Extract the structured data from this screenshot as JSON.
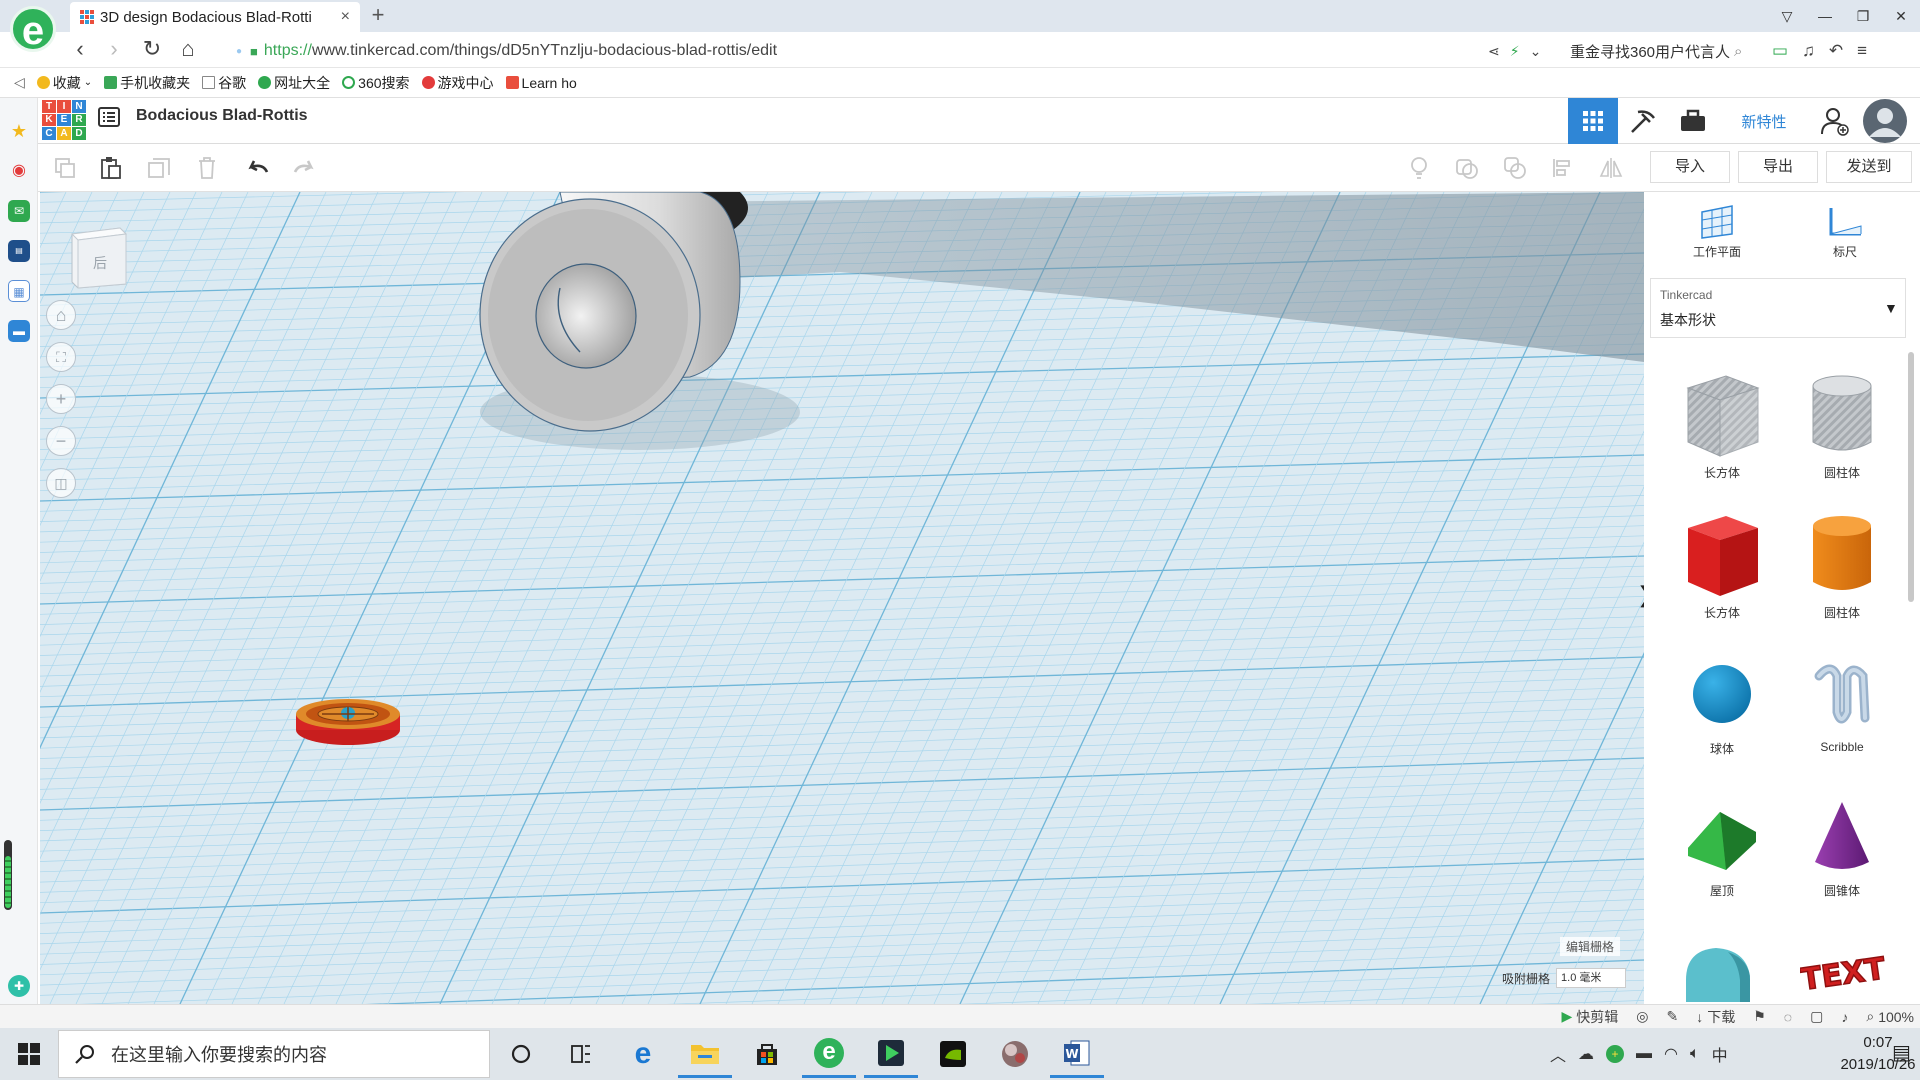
{
  "browser": {
    "logo_letter": "e",
    "tab": {
      "title": "3D design Bodacious Blad-Rotti",
      "close": "×"
    },
    "new_tab": "+",
    "window_controls": [
      "▽",
      "—",
      "❐",
      "✕"
    ],
    "nav": {
      "back": "‹",
      "forward": "›",
      "reload": "↻",
      "home": "⌂"
    },
    "url": {
      "scheme": "https://",
      "rest": "www.tinkercad.com/things/dD5nYTnzlju-bodacious-blad-rottis/edit"
    },
    "search_text": "重金寻找360用户代言人",
    "bookmarks": [
      {
        "label": "收藏",
        "color": "#f2b91e"
      },
      {
        "label": "手机收藏夹",
        "color": "#3aa757"
      },
      {
        "label": "谷歌",
        "color": "#888888"
      },
      {
        "label": "网址大全",
        "color": "#2fa84f"
      },
      {
        "label": "360搜索",
        "color": "#2fa84f"
      },
      {
        "label": "游戏中心",
        "color": "#e33b3b"
      },
      {
        "label": "Learn ho",
        "color": "#e94e3d"
      }
    ]
  },
  "tinkercad": {
    "logo": [
      "T",
      "I",
      "N",
      "K",
      "E",
      "R",
      "C",
      "A",
      "D"
    ],
    "logo_colors": [
      "#e94e3d",
      "#e94e3d",
      "#2f86d6",
      "#e94e3d",
      "#2f86d6",
      "#2fa84f",
      "#2f86d6",
      "#f2b91e",
      "#2fa84f"
    ],
    "design_title": "Bodacious Blad-Rottis",
    "new_features": "新特性",
    "toolbar": {
      "import": "导入",
      "export": "导出",
      "send_to": "发送到"
    },
    "view_cube_face": "后",
    "panel": {
      "workplane": "工作平面",
      "ruler": "标尺",
      "library_source": "Tinkercad",
      "library_name": "基本形状",
      "shapes": [
        {
          "label": "长方体",
          "icon": "box-hole-icon"
        },
        {
          "label": "圆柱体",
          "icon": "cylinder-hole-icon"
        },
        {
          "label": "长方体",
          "icon": "box-icon"
        },
        {
          "label": "圆柱体",
          "icon": "cylinder-icon"
        },
        {
          "label": "球体",
          "icon": "sphere-icon"
        },
        {
          "label": "Scribble",
          "icon": "scribble-icon"
        },
        {
          "label": "屋顶",
          "icon": "roof-icon"
        },
        {
          "label": "圆锥体",
          "icon": "cone-icon"
        }
      ],
      "text_shape_letters": "TEXT"
    },
    "edit_grid": "编辑栅格",
    "snap_label": "吸附栅格",
    "snap_value": "1.0 毫米"
  },
  "statusbar": {
    "quick_clip": "快剪辑",
    "download": "下载",
    "zoom": "100%"
  },
  "taskbar": {
    "search_placeholder": "在这里输入你要搜索的内容",
    "ime": "中",
    "time": "0:07",
    "date": "2019/10/26"
  }
}
